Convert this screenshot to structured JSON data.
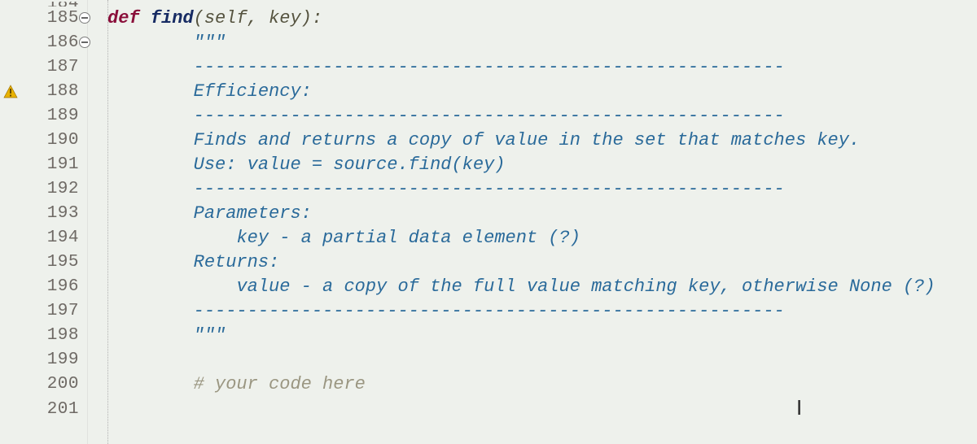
{
  "gutter": {
    "lines": [
      {
        "num": "184",
        "partial": true
      },
      {
        "num": "185",
        "fold": true
      },
      {
        "num": "186",
        "fold": true
      },
      {
        "num": "187"
      },
      {
        "num": "188",
        "warn": true
      },
      {
        "num": "189"
      },
      {
        "num": "190"
      },
      {
        "num": "191"
      },
      {
        "num": "192"
      },
      {
        "num": "193"
      },
      {
        "num": "194"
      },
      {
        "num": "195"
      },
      {
        "num": "196"
      },
      {
        "num": "197"
      },
      {
        "num": "198"
      },
      {
        "num": "199"
      },
      {
        "num": "200"
      },
      {
        "num": "201",
        "partial": true
      }
    ]
  },
  "code": {
    "l185": {
      "kw": "def ",
      "name": "find",
      "params": "(self, key):"
    },
    "l186": {
      "indent": "        ",
      "text": "\"\"\""
    },
    "l187": {
      "indent": "        ",
      "text": "-------------------------------------------------------"
    },
    "l188": {
      "indent": "        ",
      "text": "Efficiency:"
    },
    "l189": {
      "indent": "        ",
      "text": "-------------------------------------------------------"
    },
    "l190": {
      "indent": "        ",
      "text": "Finds and returns a copy of value in the set that matches key."
    },
    "l191": {
      "indent": "        ",
      "text": "Use: value = source.find(key)"
    },
    "l192": {
      "indent": "        ",
      "text": "-------------------------------------------------------"
    },
    "l193": {
      "indent": "        ",
      "text": "Parameters:"
    },
    "l194": {
      "indent": "            ",
      "text": "key - a partial data element (?)"
    },
    "l195": {
      "indent": "        ",
      "text": "Returns:"
    },
    "l196": {
      "indent": "            ",
      "text": "value - a copy of the full value matching key, otherwise None (?)"
    },
    "l197": {
      "indent": "        ",
      "text": "-------------------------------------------------------"
    },
    "l198": {
      "indent": "        ",
      "text": "\"\"\""
    },
    "l199": {
      "indent": "",
      "text": ""
    },
    "l200": {
      "indent": "        ",
      "text": "# your code here"
    }
  },
  "caret_glyph": "I"
}
